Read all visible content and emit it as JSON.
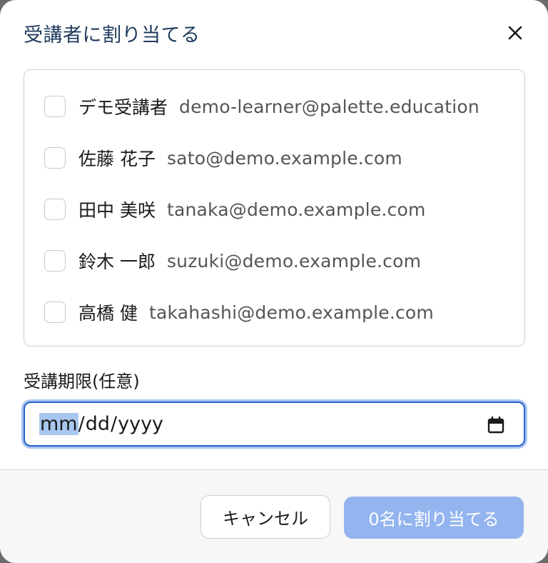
{
  "dialog": {
    "title": "受講者に割り当てる"
  },
  "learners": [
    {
      "name": "デモ受講者",
      "email": "demo-learner@palette.education",
      "checked": false
    },
    {
      "name": "佐藤 花子",
      "email": "sato@demo.example.com",
      "checked": false
    },
    {
      "name": "田中 美咲",
      "email": "tanaka@demo.example.com",
      "checked": false
    },
    {
      "name": "鈴木 一郎",
      "email": "suzuki@demo.example.com",
      "checked": false
    },
    {
      "name": "高橋 健",
      "email": "takahashi@demo.example.com",
      "checked": false
    }
  ],
  "deadline": {
    "label": "受講期限(任意)",
    "month_placeholder": "mm",
    "day_placeholder": "dd",
    "year_placeholder": "yyyy",
    "separator": "/"
  },
  "footer": {
    "cancel_label": "キャンセル",
    "assign_label": "0名に割り当てる"
  },
  "colors": {
    "title": "#1f3a5c",
    "focus_border": "#2563c9",
    "primary_disabled": "#93b4ee"
  }
}
